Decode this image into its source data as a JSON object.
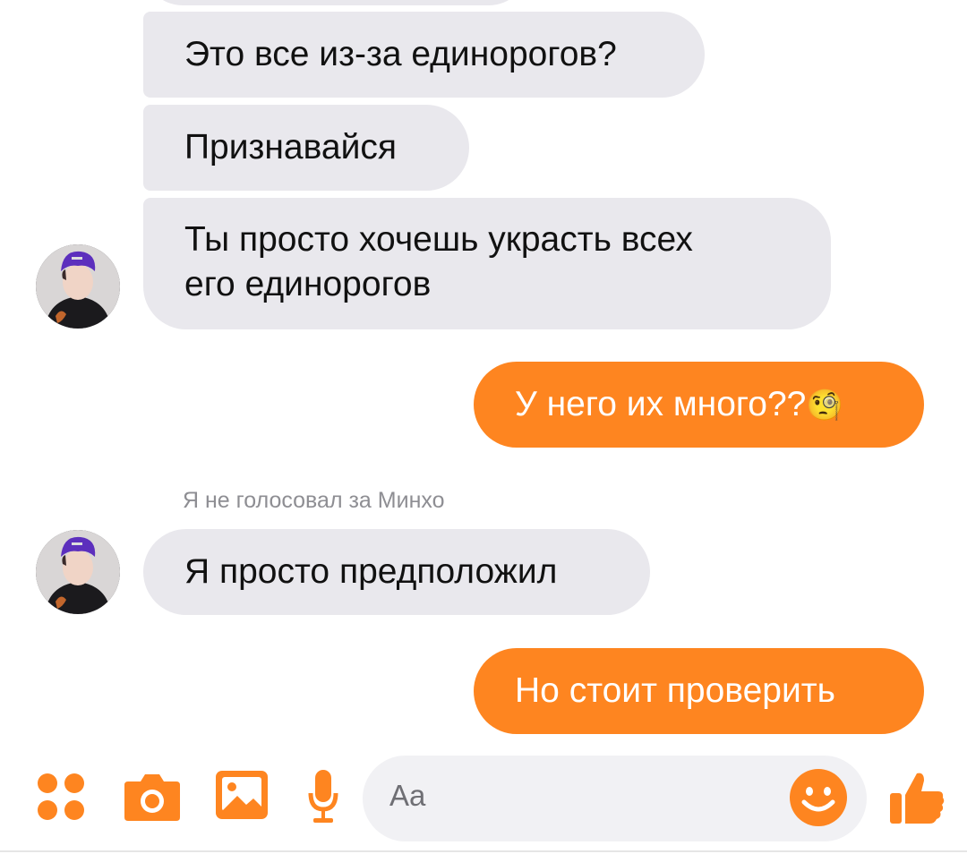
{
  "conversation": {
    "messages": [
      {
        "text": "Это все из-за единорогов?"
      },
      {
        "text": "Признавайся"
      },
      {
        "line1": "Ты просто хочешь украсть всех",
        "line2": "его единорогов"
      },
      {
        "text": "У него их много??",
        "emoji": "🧐"
      },
      {
        "sender": "Я не голосовал за Минхо"
      },
      {
        "text": "Я просто предположил"
      },
      {
        "text": "Но стоит проверить"
      }
    ]
  },
  "composer": {
    "placeholder": "Aa",
    "icons": [
      "more-dots-icon",
      "camera-icon",
      "image-icon",
      "microphone-icon",
      "emoji-icon",
      "thumbs-up-icon"
    ]
  },
  "colors": {
    "accent": "#fe8520",
    "incoming_bubble": "#e9e8ed",
    "sender_label": "#8e8e93"
  }
}
